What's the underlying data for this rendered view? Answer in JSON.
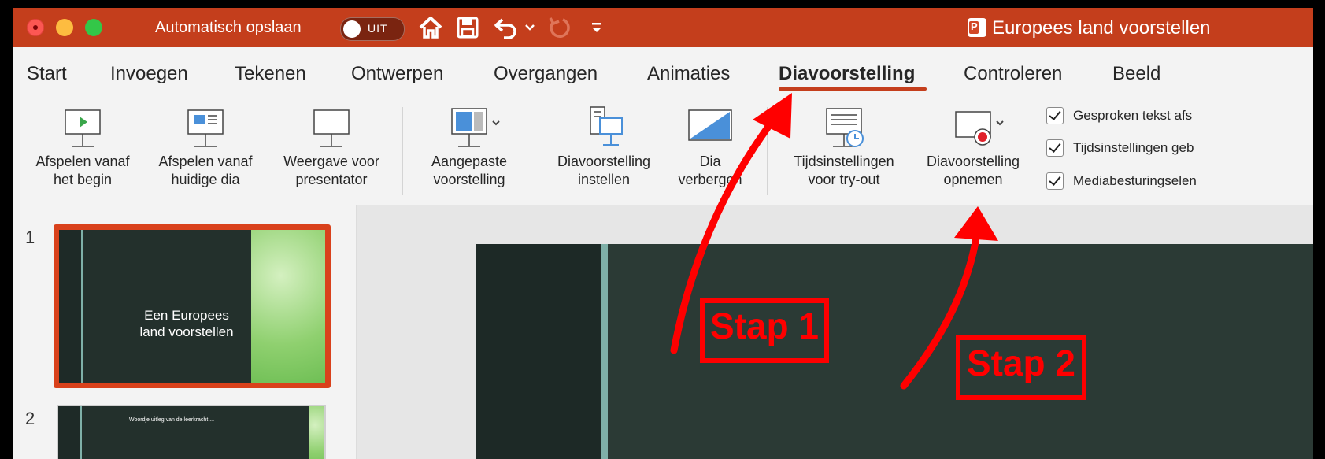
{
  "titlebar": {
    "autosave_label": "Automatisch opslaan",
    "autosave_state": "UIT",
    "document_title": "Europees land voorstellen",
    "accent_color": "#c43e1c",
    "icons": [
      "home-icon",
      "save-icon",
      "undo-icon",
      "chevron-down-icon",
      "redo-icon",
      "customize-toolbar-icon"
    ]
  },
  "tabs": [
    {
      "label": "Start"
    },
    {
      "label": "Invoegen"
    },
    {
      "label": "Tekenen"
    },
    {
      "label": "Ontwerpen"
    },
    {
      "label": "Overgangen"
    },
    {
      "label": "Animaties"
    },
    {
      "label": "Diavoorstelling",
      "active": true
    },
    {
      "label": "Controleren"
    },
    {
      "label": "Beeld"
    }
  ],
  "ribbon": {
    "play_from_start": {
      "line1": "Afspelen vanaf",
      "line2": "het begin"
    },
    "play_from_current": {
      "line1": "Afspelen vanaf",
      "line2": "huidige dia"
    },
    "presenter_view": {
      "line1": "Weergave voor",
      "line2": "presentator"
    },
    "custom_show": {
      "line1": "Aangepaste",
      "line2": "voorstelling"
    },
    "setup_show": {
      "line1": "Diavoorstelling",
      "line2": "instellen"
    },
    "hide_slide": {
      "line1": "Dia",
      "line2": "verbergen"
    },
    "rehearse_timings": {
      "line1": "Tijdsinstellingen",
      "line2": "voor try-out"
    },
    "record_show": {
      "line1": "Diavoorstelling",
      "line2": "opnemen"
    },
    "checkboxes": [
      {
        "label": "Gesproken tekst afs",
        "checked": true
      },
      {
        "label": "Tijdsinstellingen geb",
        "checked": true
      },
      {
        "label": "Mediabesturingselen",
        "checked": true
      }
    ]
  },
  "slides": [
    {
      "number": "1",
      "title": "Een Europees\nland voorstellen",
      "selected": true
    },
    {
      "number": "2",
      "title": "Woordje uitleg van de leerkracht ..."
    }
  ],
  "annotations": {
    "step1": "Stap 1",
    "step2": "Stap 2",
    "color": "#ff0000"
  }
}
